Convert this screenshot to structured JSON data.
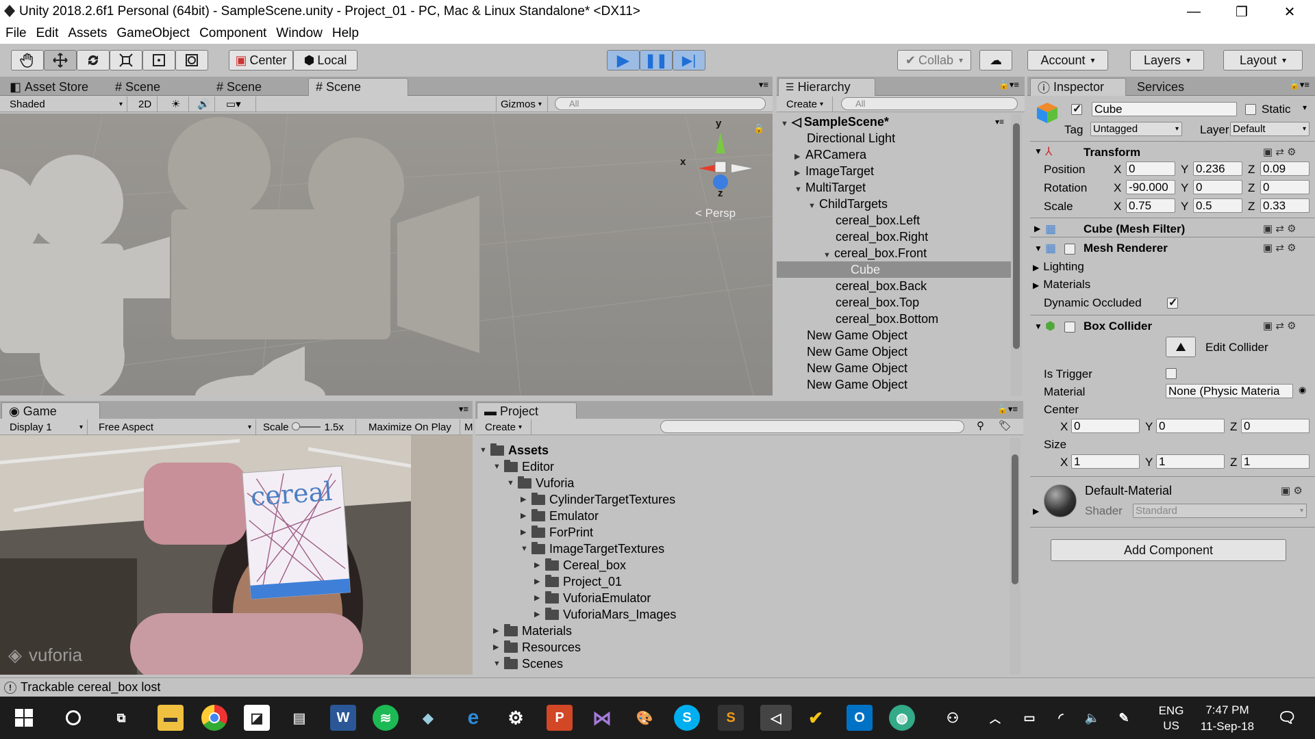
{
  "window": {
    "title": "Unity 2018.2.6f1 Personal (64bit) - SampleScene.unity - Project_01 - PC, Mac & Linux Standalone* <DX11>"
  },
  "menu": [
    "File",
    "Edit",
    "Assets",
    "GameObject",
    "Component",
    "Window",
    "Help"
  ],
  "toolbar": {
    "pivot": "Center",
    "space": "Local",
    "collab": "Collab",
    "account": "Account",
    "layers": "Layers",
    "layout": "Layout"
  },
  "scene_panel": {
    "tabs": [
      "Asset Store",
      "Scene",
      "Scene",
      "Scene"
    ],
    "shading": "Shaded",
    "mode2d": "2D",
    "gizmos": "Gizmos",
    "search_placeholder": "All",
    "gizmo_y": "y",
    "gizmo_x": "x",
    "gizmo_z": "z",
    "persp": "Persp"
  },
  "hierarchy": {
    "tab": "Hierarchy",
    "create": "Create",
    "search_placeholder": "All",
    "scene": "SampleScene*",
    "items": [
      {
        "label": "Directional Light"
      },
      {
        "label": "ARCamera"
      },
      {
        "label": "ImageTarget"
      },
      {
        "label": "MultiTarget"
      },
      {
        "label": "ChildTargets"
      },
      {
        "label": "cereal_box.Left"
      },
      {
        "label": "cereal_box.Right"
      },
      {
        "label": "cereal_box.Front"
      },
      {
        "label": "Cube"
      },
      {
        "label": "cereal_box.Back"
      },
      {
        "label": "cereal_box.Top"
      },
      {
        "label": "cereal_box.Bottom"
      },
      {
        "label": "New Game Object"
      },
      {
        "label": "New Game Object"
      },
      {
        "label": "New Game Object"
      },
      {
        "label": "New Game Object"
      }
    ]
  },
  "inspector": {
    "tab": "Inspector",
    "tab2": "Services",
    "object_name": "Cube",
    "static_label": "Static",
    "tag_label": "Tag",
    "tag_value": "Untagged",
    "layer_label": "Layer",
    "layer_value": "Default",
    "transform": {
      "title": "Transform",
      "position_label": "Position",
      "rotation_label": "Rotation",
      "scale_label": "Scale",
      "axis_x": "X",
      "axis_y": "Y",
      "axis_z": "Z",
      "position": {
        "x": "0",
        "y": "0.236",
        "z": "0.09"
      },
      "rotation": {
        "x": "-90.000",
        "y": "0",
        "z": "0"
      },
      "scale": {
        "x": "0.75",
        "y": "0.5",
        "z": "0.33"
      }
    },
    "mesh_filter": "Cube (Mesh Filter)",
    "mesh_renderer": {
      "title": "Mesh Renderer",
      "lighting": "Lighting",
      "materials": "Materials",
      "dynamic_occluded": "Dynamic Occluded"
    },
    "box_collider": {
      "title": "Box Collider",
      "edit_collider": "Edit Collider",
      "is_trigger": "Is Trigger",
      "material_label": "Material",
      "material_value": "None (Physic Materia",
      "center_label": "Center",
      "center": {
        "x": "0",
        "y": "0",
        "z": "0"
      },
      "size_label": "Size",
      "size": {
        "x": "1",
        "y": "1",
        "z": "1"
      }
    },
    "material": {
      "name": "Default-Material",
      "shader_label": "Shader",
      "shader_value": "Standard"
    },
    "add_component": "Add Component"
  },
  "game_panel": {
    "tab": "Game",
    "display": "Display 1",
    "aspect": "Free Aspect",
    "scale_label": "Scale",
    "scale_value": "1.5x",
    "maximize": "Maximize On Play",
    "mute": "Mu",
    "box_text": "cereal",
    "watermark": "vuforia"
  },
  "project_panel": {
    "tab": "Project",
    "create": "Create",
    "items": [
      {
        "label": "Assets",
        "bold": true
      },
      {
        "label": "Editor"
      },
      {
        "label": "Vuforia"
      },
      {
        "label": "CylinderTargetTextures"
      },
      {
        "label": "Emulator"
      },
      {
        "label": "ForPrint"
      },
      {
        "label": "ImageTargetTextures"
      },
      {
        "label": "Cereal_box"
      },
      {
        "label": "Project_01"
      },
      {
        "label": "VuforiaEmulator"
      },
      {
        "label": "VuforiaMars_Images"
      },
      {
        "label": "Materials"
      },
      {
        "label": "Resources"
      },
      {
        "label": "Scenes"
      }
    ]
  },
  "status": {
    "message": "Trackable cereal_box lost"
  },
  "taskbar": {
    "lang": "ENG",
    "region": "US",
    "time": "7:47 PM",
    "date": "11-Sep-18"
  },
  "colors": {
    "play_blue": "#1f6fd6",
    "selection": "#8e8e8e",
    "taskbar": "#1c1c1c"
  }
}
